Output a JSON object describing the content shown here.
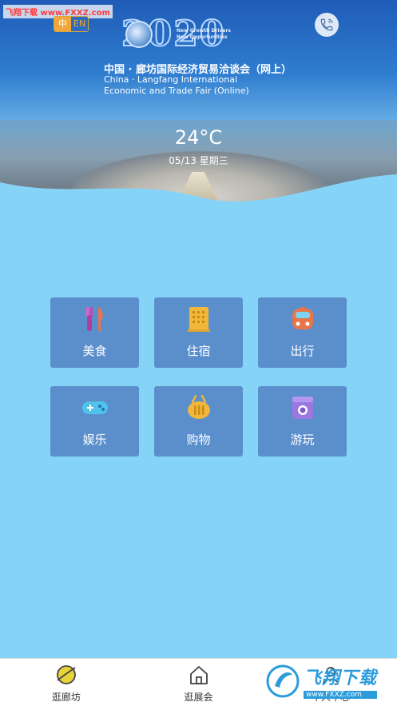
{
  "header": {
    "watermark": "飞翔下载 www.FXXZ.com",
    "lang": {
      "zh": "中",
      "en": "EN"
    },
    "year": "2020",
    "slogan_line1": "New Growth Drivers",
    "slogan_line2": "New Opportunities",
    "title_cn": "中国 · 廊坊国际经济贸易洽谈会（网上）",
    "title_en_line1": "China · Langfang International",
    "title_en_line2": "Economic and Trade Fair (Online)",
    "temperature": "24°C",
    "date": "05/13 星期三"
  },
  "grid": {
    "items": [
      {
        "label": "美食",
        "icon": "fork-knife-icon",
        "color": "#c447b0"
      },
      {
        "label": "住宿",
        "icon": "building-icon",
        "color": "#f1b73a"
      },
      {
        "label": "出行",
        "icon": "bus-icon",
        "color": "#e8744a"
      },
      {
        "label": "娱乐",
        "icon": "gamepad-icon",
        "color": "#4fc3e8"
      },
      {
        "label": "购物",
        "icon": "basket-icon",
        "color": "#f1b73a"
      },
      {
        "label": "游玩",
        "icon": "camera-icon",
        "color": "#9a78e0"
      }
    ]
  },
  "tabbar": {
    "tabs": [
      {
        "label": "逛廊坊",
        "icon": "planet-icon"
      },
      {
        "label": "逛展会",
        "icon": "home-icon"
      },
      {
        "label": "个人中心",
        "icon": "user-icon"
      }
    ]
  },
  "brand_watermark": {
    "text": "飞翔下载",
    "url": "www.FXXZ.com"
  },
  "colors": {
    "page_bg": "#86d3f8",
    "tile_bg": "#5b8fcc",
    "accent": "#f1a73a"
  }
}
